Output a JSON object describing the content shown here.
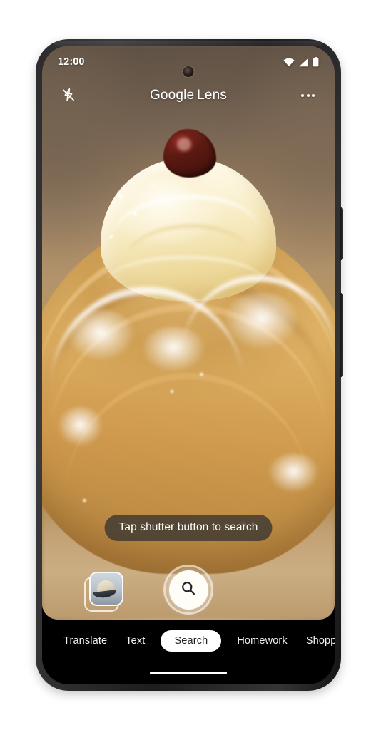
{
  "device": {
    "frame_color": "#2b2b2d",
    "buttons": [
      {
        "name": "volume-button"
      },
      {
        "name": "power-button"
      }
    ],
    "camera": "punch-hole-front-camera"
  },
  "status_bar": {
    "time": "12:00",
    "icons": [
      {
        "name": "wifi-icon"
      },
      {
        "name": "cellular-signal-icon"
      },
      {
        "name": "battery-icon"
      }
    ]
  },
  "app_bar": {
    "flash_icon": "flash-off-icon",
    "brand": "Google",
    "product": "Lens",
    "more_icon": "more-options-icon"
  },
  "viewfinder": {
    "subject": "powdered-sugar cream puff pastry with cherry",
    "accent": "#c79a4f"
  },
  "hint": {
    "text": "Tap shutter button to search"
  },
  "capture": {
    "gallery_thumbnail_label": "gallery-thumbnail",
    "shutter_icon": "search-icon",
    "shutter_label": "Search"
  },
  "mode_nav": {
    "selected": "Search",
    "items": [
      {
        "label": "Translate",
        "selected": false
      },
      {
        "label": "Text",
        "selected": false
      },
      {
        "label": "Search",
        "selected": true
      },
      {
        "label": "Homework",
        "selected": false
      },
      {
        "label": "Shopping",
        "selected": false
      }
    ]
  },
  "system_nav": {
    "home_indicator": "home-indicator"
  }
}
